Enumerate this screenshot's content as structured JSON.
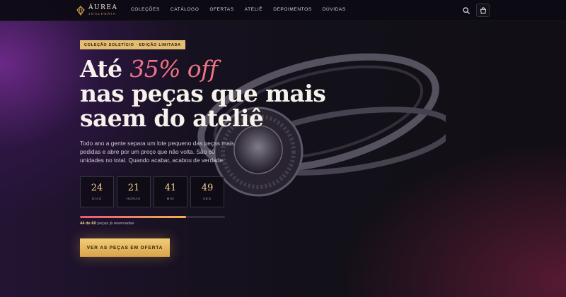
{
  "brand": {
    "name": "ÁUREA",
    "subtitle": "JOALHERIA",
    "logo_icon": "diamond-icon"
  },
  "nav": {
    "items": [
      {
        "label": "COLEÇÕES"
      },
      {
        "label": "CATÁLOGO"
      },
      {
        "label": "OFERTAS"
      },
      {
        "label": "ATELIÊ"
      },
      {
        "label": "DEPOIMENTOS"
      },
      {
        "label": "DÚVIDAS"
      }
    ],
    "search_icon": "search-icon",
    "bag_icon": "shopping-bag-icon"
  },
  "hero": {
    "badge": "COLEÇÃO SOLSTÍCIO · EDIÇÃO LIMITADA",
    "headline": {
      "prefix": "Até ",
      "accent": "35% off",
      "line2": "nas peças que mais",
      "line3": "saem do ateliê"
    },
    "description": "Todo ano a gente separa um lote pequeno das peças mais pedidas e abre por um preço que não volta. São 60 unidades no total. Quando acabar, acabou de verdade.",
    "countdown": [
      {
        "value": "24",
        "label": "DIAS"
      },
      {
        "value": "21",
        "label": "HORAS"
      },
      {
        "value": "41",
        "label": "MIN"
      },
      {
        "value": "49",
        "label": "SEG"
      }
    ],
    "progress": {
      "reserved": 44,
      "total": 60,
      "fraction": 0.733,
      "count_text": "44 de 60",
      "suffix_text": " peças já reservadas"
    },
    "cta_label": "VER AS PEÇAS EM OFERTA"
  },
  "colors": {
    "accent_pink": "#f07387",
    "gold": "#e2bd73",
    "background": "#0f0c16"
  }
}
